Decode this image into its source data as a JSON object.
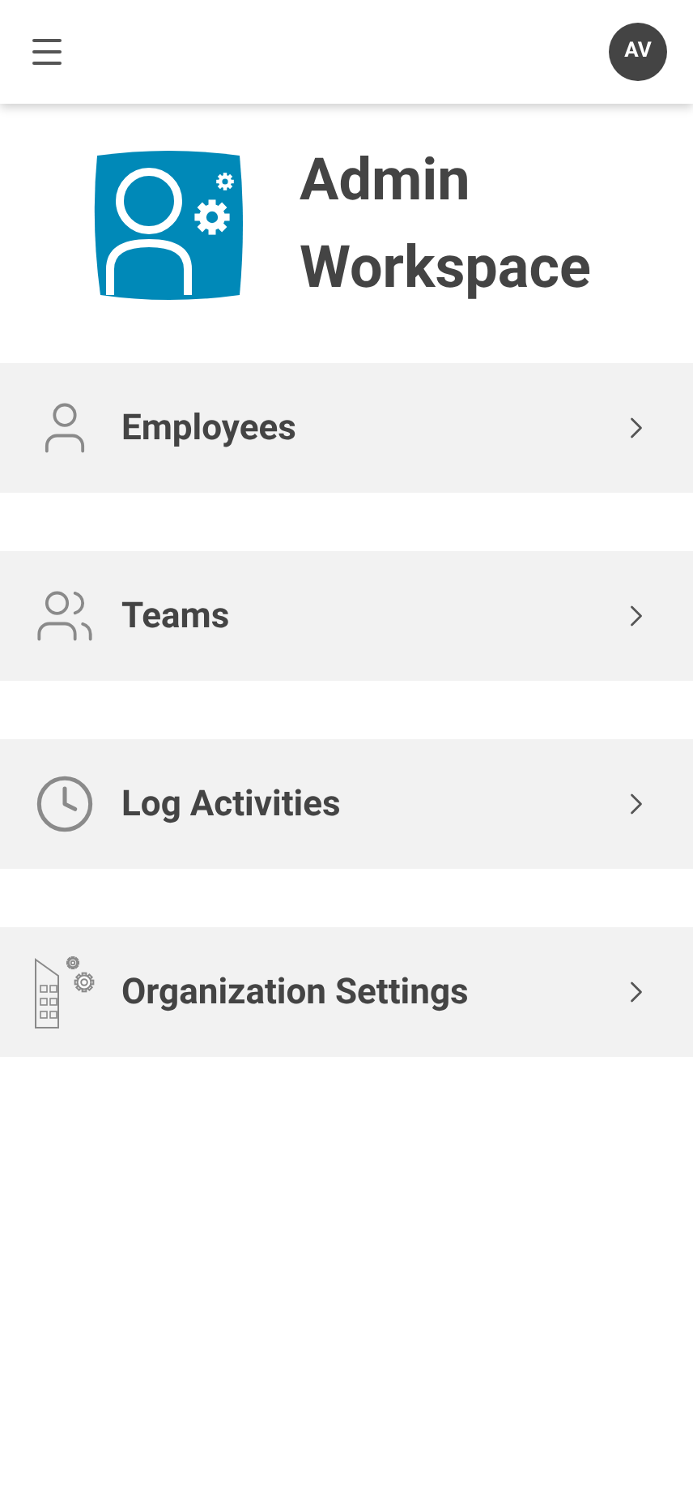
{
  "header": {
    "avatar": "AV"
  },
  "title": [
    "Admin",
    "Workspace"
  ],
  "items": [
    {
      "kind": "person",
      "label": "Employees"
    },
    {
      "kind": "team",
      "label": "Teams"
    },
    {
      "kind": "clock",
      "label": "Log Activities"
    },
    {
      "kind": "building",
      "label": "Organization Settings"
    }
  ]
}
